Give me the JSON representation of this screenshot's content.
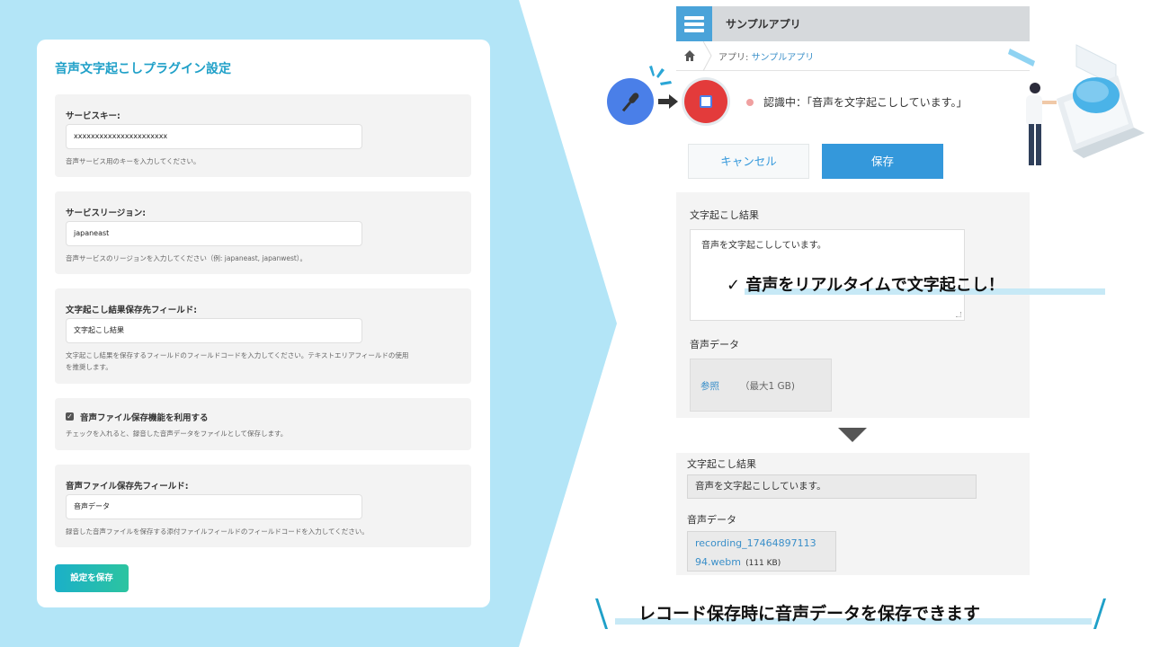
{
  "settings": {
    "title": "音声文字起こしプラグイン設定",
    "service_key": {
      "label": "サービスキー:",
      "value": "xxxxxxxxxxxxxxxxxxxxxx",
      "help": "音声サービス用のキーを入力してください。"
    },
    "service_region": {
      "label": "サービスリージョン:",
      "value": "japaneast",
      "help": "音声サービスのリージョンを入力してください（例: japaneast, japanwest）。"
    },
    "result_field": {
      "label": "文字起こし結果保存先フィールド:",
      "value": "文字起こし結果",
      "help_line1": "文字起こし結果を保存するフィールドのフィールドコードを入力してください。テキストエリアフィールドの使用",
      "help_line2": "を推奨します。"
    },
    "audio_save": {
      "label": "音声ファイル保存機能を利用する",
      "checked": true,
      "help": "チェックを入れると、録音した音声データをファイルとして保存します。"
    },
    "audio_field": {
      "label": "音声ファイル保存先フィールド:",
      "value": "音声データ",
      "help": "録音した音声ファイルを保存する添付ファイルフィールドのフィールドコードを入力してください。"
    },
    "save_label": "設定を保存"
  },
  "app": {
    "name": "サンプルアプリ",
    "breadcrumb_prefix": "アプリ: ",
    "breadcrumb_link": "サンプルアプリ",
    "status": "認識中：「音声を文字起こししています。」",
    "cancel_label": "キャンセル",
    "save_label": "保存",
    "form": {
      "transcript_label": "文字起こし結果",
      "transcript_value": "音声を文字起こししています。",
      "audio_label": "音声データ",
      "browse_label": "参照",
      "max_size": "（最大1 GB)"
    },
    "result": {
      "transcript_label": "文字起こし結果",
      "transcript_value": "音声を文字起こししています。",
      "audio_label": "音声データ",
      "file_line1": "recording_17464897113",
      "file_line2": "94.webm",
      "file_size": "(111 KB)"
    }
  },
  "callout": "✓ 音声をリアルタイムで文字起こし！",
  "caption": "レコード保存時に音声データを保存できます",
  "colors": {
    "accent": "#1fa0c8",
    "background_shape": "#b3e5f7",
    "primary_button": "#3498db",
    "record_red": "#e33b3b",
    "mic_blue": "#4a7fe8"
  }
}
